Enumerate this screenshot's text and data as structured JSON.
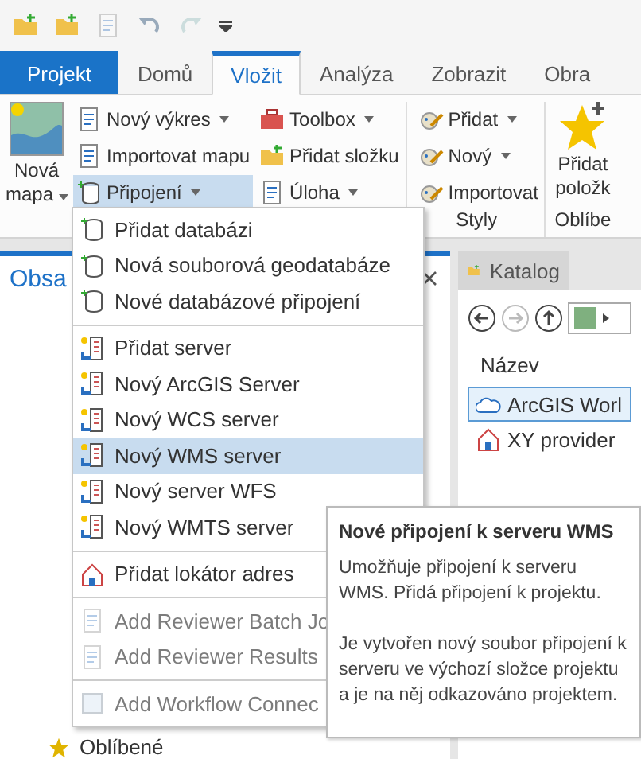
{
  "tabs": [
    {
      "label": "Projekt",
      "kind": "backstage",
      "selected": false
    },
    {
      "label": "Domů",
      "kind": "tab",
      "selected": false
    },
    {
      "label": "Vložit",
      "kind": "tab",
      "selected": true
    },
    {
      "label": "Analýza",
      "kind": "tab",
      "selected": false
    },
    {
      "label": "Zobrazit",
      "kind": "tab",
      "selected": false
    },
    {
      "label": "Obra",
      "kind": "tab",
      "selected": false
    }
  ],
  "ribbon": {
    "big_button": {
      "label": "Nová mapa",
      "dropdown": true
    },
    "columns": [
      [
        {
          "label": "Nový výkres",
          "dropdown": true,
          "pressed": false
        },
        {
          "label": "Importovat mapu",
          "dropdown": false,
          "pressed": false
        },
        {
          "label": "Připojení",
          "dropdown": true,
          "pressed": true
        }
      ],
      [
        {
          "label": "Toolbox",
          "dropdown": true,
          "pressed": false
        },
        {
          "label": "Přidat složku",
          "dropdown": false,
          "pressed": false
        },
        {
          "label": "Úloha",
          "dropdown": true,
          "pressed": false
        }
      ]
    ],
    "styles_group": {
      "label": "Styly",
      "items": [
        {
          "label": "Přidat",
          "dropdown": true,
          "pressed": false
        },
        {
          "label": "Nový",
          "dropdown": true,
          "pressed": false
        },
        {
          "label": "Importovat",
          "dropdown": false,
          "pressed": false
        }
      ]
    },
    "favorites_group": {
      "label": "Oblíbe",
      "button_lines": [
        "Přidat",
        "položk"
      ]
    }
  },
  "contents_pane": {
    "title": "Obsa",
    "favorites": "Oblíbené"
  },
  "catalog_pane": {
    "tab": "Katalog",
    "column": "Název",
    "rows": [
      {
        "label": "ArcGIS Worl",
        "selected": true
      },
      {
        "label": "XY provider",
        "selected": false
      }
    ]
  },
  "menu": {
    "sections": [
      [
        {
          "label": "Přidat databázi",
          "selected": false,
          "disabled": false
        },
        {
          "label": "Nová souborová geodatabáze",
          "selected": false,
          "disabled": false
        },
        {
          "label": "Nové databázové připojení",
          "selected": false,
          "disabled": false
        }
      ],
      [
        {
          "label": "Přidat server",
          "selected": false,
          "disabled": false
        },
        {
          "label": "Nový ArcGIS Server",
          "selected": false,
          "disabled": false
        },
        {
          "label": "Nový WCS server",
          "selected": false,
          "disabled": false
        },
        {
          "label": "Nový WMS server",
          "selected": true,
          "disabled": false
        },
        {
          "label": "Nový server WFS",
          "selected": false,
          "disabled": false
        },
        {
          "label": "Nový WMTS server",
          "selected": false,
          "disabled": false
        }
      ],
      [
        {
          "label": "Přidat lokátor adres",
          "selected": false,
          "disabled": false
        }
      ],
      [
        {
          "label": "Add Reviewer Batch Jo",
          "selected": false,
          "disabled": true
        },
        {
          "label": "Add Reviewer Results",
          "selected": false,
          "disabled": true
        }
      ],
      [
        {
          "label": "Add Workflow Connec",
          "selected": false,
          "disabled": true
        }
      ]
    ]
  },
  "tooltip": {
    "title": "Nové připojení k serveru WMS",
    "paragraphs": [
      "Umožňuje připojení k serveru WMS. Přidá připojení k projektu.",
      "Je vytvořen nový soubor připojení k serveru ve výchozí složce projektu a je na něj odkazováno projektem."
    ]
  }
}
